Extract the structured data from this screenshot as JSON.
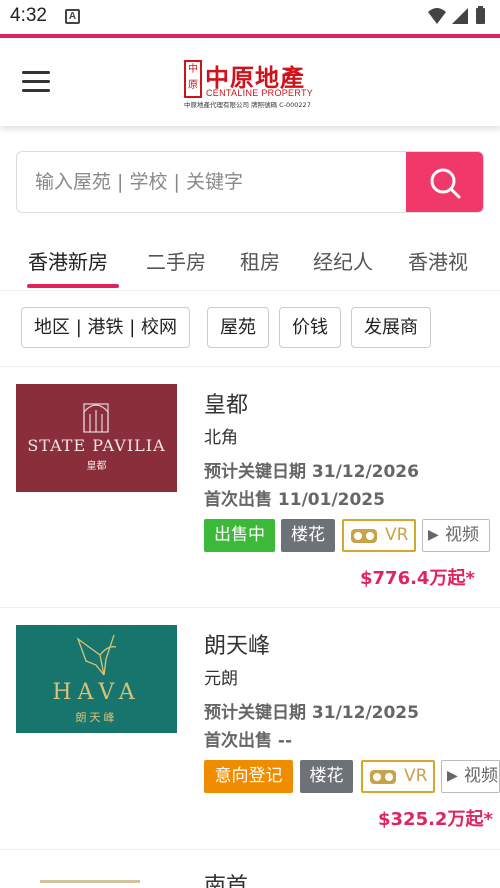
{
  "status_bar": {
    "time": "4:32",
    "notification_icon": "A"
  },
  "header": {
    "logo": {
      "seal_text": "中原",
      "name_cn": "中原地產",
      "name_en": "CENTALINE PROPERTY",
      "sub": "中原地產代理有限公司 牌照號碼 C-000227"
    }
  },
  "search": {
    "placeholder": "输入屋苑 | 学校 | 关键字"
  },
  "tabs": [
    "香港新房",
    "二手房",
    "租房",
    "经纪人",
    "香港视"
  ],
  "filters": [
    "地区 | 港铁 | 校网",
    "屋苑",
    "价钱",
    "发展商"
  ],
  "listings": [
    {
      "name": "皇都",
      "district": "北角",
      "key_date": "预计关键日期 31/12/2026",
      "first_sale": "首次出售 11/01/2025",
      "status": "出售中",
      "status_color": "#3cb939",
      "type": "楼花",
      "vr": "VR",
      "video": "视频",
      "price": "$776.4万起*",
      "thumb": {
        "brand": "STATE PAVILIA",
        "brand_cn": "皇都",
        "bg": "#8b2e3c"
      }
    },
    {
      "name": "朗天峰",
      "district": "元朗",
      "key_date": "预计关键日期 31/12/2025",
      "first_sale": "首次出售 --",
      "status": "意向登记",
      "status_color": "#f08c00",
      "type": "楼花",
      "vr": "VR",
      "video": "视频",
      "price": "$325.2万起*",
      "thumb": {
        "brand": "HAVA",
        "brand_cn": "朗天峰",
        "bg": "#17756e"
      }
    },
    {
      "name": "南首"
    }
  ]
}
